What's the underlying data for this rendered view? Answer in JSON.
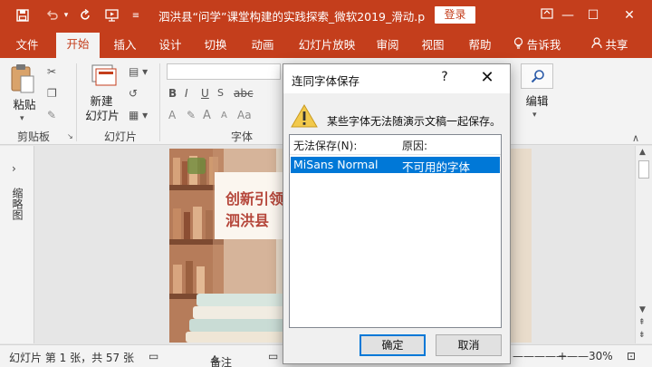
{
  "window": {
    "title": "泗洪县“问学”课堂构建的实践探索_微软2019_滑动.p...",
    "login_label": "登录",
    "minimize_glyph": "—",
    "restore_glyph": "☐",
    "close_glyph": "✕"
  },
  "tabs": [
    "文件",
    "开始",
    "插入",
    "设计",
    "切换",
    "动画",
    "幻灯片放映",
    "审阅",
    "视图",
    "帮助",
    "告诉我",
    "共享"
  ],
  "active_tab": "开始",
  "ribbon": {
    "paste_label": "粘贴",
    "clipboard_group": "剪贴板",
    "new_slide_line1": "新建",
    "new_slide_line2": "幻灯片",
    "slides_group": "幻灯片",
    "font_group": "字体",
    "font_size_labels": [
      "A",
      "A",
      "A"
    ],
    "edit_label": "编辑"
  },
  "thumbnail_pane": {
    "label": "缩略图"
  },
  "slide": {
    "title_line1": "创新引领",
    "title_line2": "泗洪县"
  },
  "status": {
    "slide_info": "幻灯片 第 1 张，共 57 张",
    "notes_label": "备注",
    "zoom": "30%"
  },
  "dialog": {
    "title": "连同字体保存",
    "help_glyph": "?",
    "close_glyph": "✕",
    "message": "某些字体无法随演示文稿一起保存。",
    "col_font": "无法保存(N):",
    "col_reason": "原因:",
    "rows": [
      {
        "font": "MiSans Normal",
        "reason": "不可用的字体"
      }
    ],
    "ok_label": "确定",
    "cancel_label": "取消"
  },
  "colors": {
    "brand": "#c43e1c",
    "selection": "#0078d7"
  }
}
